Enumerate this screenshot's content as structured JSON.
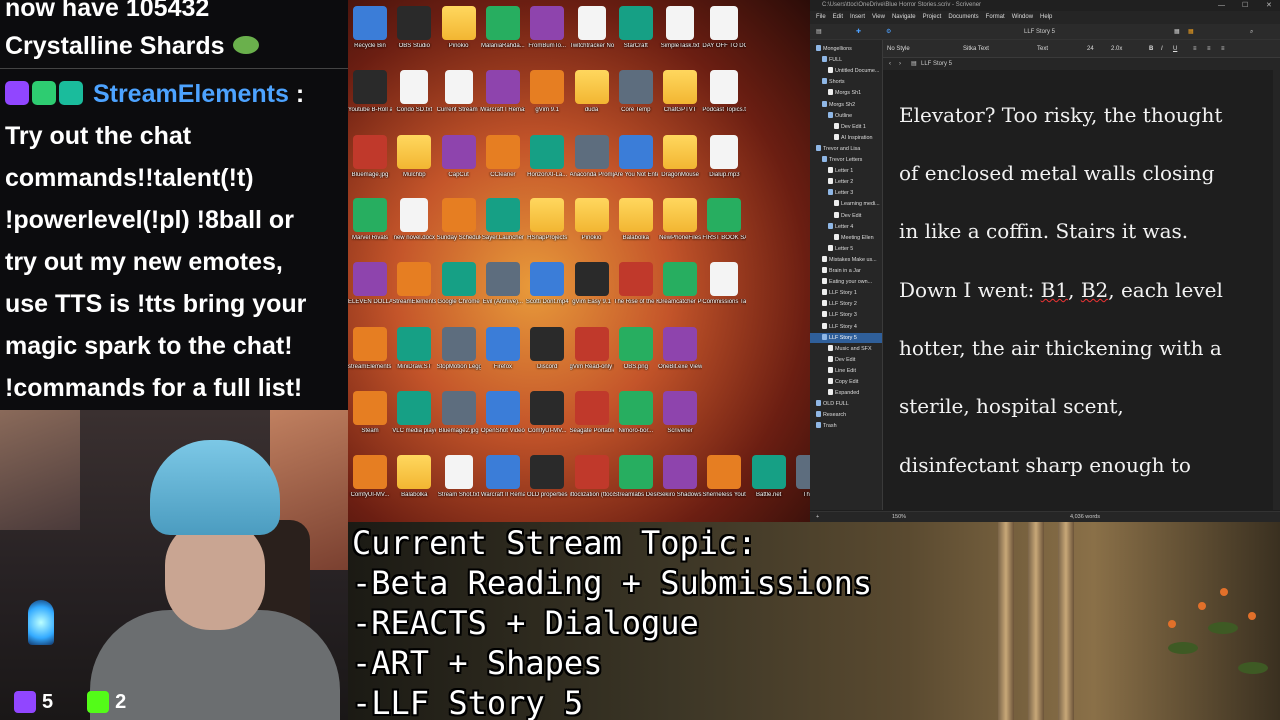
{
  "chat": {
    "line1": "now have 105432",
    "line2": "Crystalline Shards",
    "username": "StreamElements",
    "colon": " :",
    "msg": [
      "Try out the chat",
      "commands!!talent(!t)",
      "!powerlevel(!pl) !8ball or",
      "try out my new emotes,",
      "use TTS is !tts bring your",
      "magic spark to the chat!",
      "!commands for a full list!"
    ],
    "colors": {
      "username": "#4da3ff",
      "twitch": "#9146ff",
      "kick": "#53fc18"
    }
  },
  "counters": {
    "twitch": "5",
    "kick": "2"
  },
  "desktop": {
    "icons": [
      "Recycle Bin",
      "OBS Studio",
      "Pinokio",
      "MalaniaRahda...",
      "FromBumTo...",
      "Twitchtracker Notes.txt",
      "StarCraft",
      "SimpleTask.txt",
      "DAY OFF TO DO LIST.txt",
      "Youtube B-Roll and Music",
      "Condo SD.txt",
      "Current Stream Topic.txt",
      "Warcraft I Remastered",
      "gVim 9.1",
      "duda",
      "Core Temp",
      "ChatGPTVT",
      "Podcast Topics.txt",
      "Bluemage.jpg",
      "Mulchbp",
      "CapCut",
      "CCleaner",
      "HorizonXI-La...",
      "Anaconda Prompt (2)",
      "Are You Not Entertained.mp4",
      "DragonMouse",
      "Dialup.mp3",
      "Marvel Rivals",
      "new novel.docx",
      "Sunday Scheduler",
      "Sayer.Launcher",
      "HSnapProjects",
      "Pinokio",
      "Balabolka",
      "NewPhoneFiles",
      "FIRST BOOK SALE TO B...",
      "ELEVEN DOLLAR FOUNDATION",
      "StreamElements Stream...",
      "Google Chrome",
      "Evil (Archive)...",
      "Scotti Dont.mp4",
      "gVim Easy 9.1",
      "The Rise of the Knight",
      "Dreamcatcher Pretty Derby",
      "Commissions Tablet.txt",
      "streamElements Stream...",
      "MiniDraw.ST",
      "StopMotion Leggo",
      "Firefox",
      "Discord",
      "gVim Read-only 9.1",
      "OBS.png",
      "OneBit.exe Viewer",
      "Steam",
      "VLC media player",
      "Bluemage2.jpg",
      "OpenShot Video Editor",
      "ComfyUI-MV...",
      "Seagate Portable Disk",
      "Nimoro-bor...",
      "Scrivener",
      "ComfyUI-MV...",
      "Balabolka",
      "Stream Shot.txt",
      "Warcraft II Remastered",
      "OLD properties",
      "ittoclization (ttocc) - C...",
      "Streamlabs Desktop",
      "Sekiro Shadows D...",
      "Sherneless Youtube...",
      "Battle.net",
      "Thum..."
    ]
  },
  "scrivener": {
    "title": "C:\\Users\\ttoc\\OneDrive\\Blue Horror Stories.scriv - Scrivener",
    "menu": [
      "File",
      "Edit",
      "Insert",
      "View",
      "Navigate",
      "Project",
      "Documents",
      "Format",
      "Window",
      "Help"
    ],
    "toolbar_doc_title": "LLF Story 5",
    "format": {
      "style": "No Style",
      "font": "Sitka Text",
      "typeface": "Text",
      "size": "24",
      "spacing": "2.0x"
    },
    "binder": [
      {
        "label": "Mongellions",
        "level": 0,
        "folder": true
      },
      {
        "label": "FULL",
        "level": 1,
        "folder": true
      },
      {
        "label": "Untitled Docume...",
        "level": 2,
        "folder": false
      },
      {
        "label": "Shorts",
        "level": 1,
        "folder": true
      },
      {
        "label": "Morgs Sh1",
        "level": 2,
        "folder": false
      },
      {
        "label": "Morgs Sh2",
        "level": 1,
        "folder": true
      },
      {
        "label": "Outline",
        "level": 2,
        "folder": true
      },
      {
        "label": "Dev Edit 1",
        "level": 3,
        "folder": false
      },
      {
        "label": "AI Inspiration",
        "level": 3,
        "folder": false
      },
      {
        "label": "Trevor and Lisa",
        "level": 0,
        "folder": true
      },
      {
        "label": "Trevor Letters",
        "level": 1,
        "folder": true
      },
      {
        "label": "Letter 1",
        "level": 2,
        "folder": false
      },
      {
        "label": "Letter 2",
        "level": 2,
        "folder": false
      },
      {
        "label": "Letter 3",
        "level": 2,
        "folder": true
      },
      {
        "label": "Learning medi...",
        "level": 3,
        "folder": false
      },
      {
        "label": "Dev Edit",
        "level": 3,
        "folder": false
      },
      {
        "label": "Letter 4",
        "level": 2,
        "folder": true
      },
      {
        "label": "Meeting Ellen",
        "level": 3,
        "folder": false
      },
      {
        "label": "Letter 5",
        "level": 2,
        "folder": false
      },
      {
        "label": "Mistakes Make us...",
        "level": 1,
        "folder": false
      },
      {
        "label": "Brain in a Jar",
        "level": 1,
        "folder": false
      },
      {
        "label": "Eating your own...",
        "level": 1,
        "folder": false
      },
      {
        "label": "LLF Story 1",
        "level": 1,
        "folder": false
      },
      {
        "label": "LLF Story 2",
        "level": 1,
        "folder": false
      },
      {
        "label": "LLF Story 3",
        "level": 1,
        "folder": false
      },
      {
        "label": "LLF Story 4",
        "level": 1,
        "folder": false
      },
      {
        "label": "LLF Story 5",
        "level": 1,
        "folder": true,
        "selected": true
      },
      {
        "label": "Music and SFX",
        "level": 2,
        "folder": false
      },
      {
        "label": "Dev Edit",
        "level": 2,
        "folder": false
      },
      {
        "label": "Line Edit",
        "level": 2,
        "folder": false
      },
      {
        "label": "Copy Edit",
        "level": 2,
        "folder": false
      },
      {
        "label": "Expanded",
        "level": 2,
        "folder": false
      },
      {
        "label": "OLD FULL",
        "level": 0,
        "folder": true
      },
      {
        "label": "Research",
        "level": 0,
        "folder": true
      },
      {
        "label": "Trash",
        "level": 0,
        "folder": true
      }
    ],
    "editor_lines": [
      "Elevator? Too risky, the thought",
      "of enclosed metal walls closing",
      "in like a coffin. Stairs it was.",
      "Down I went: B1, B2, each level",
      "hotter, the air thickening with a",
      "sterile, hospital scent,",
      "disinfectant sharp enough to"
    ],
    "status": {
      "zoom": "150%",
      "words": "4,036 words"
    },
    "colors": {
      "selection": "#2f5f9a"
    }
  },
  "topic": {
    "lines": [
      "Current Stream Topic:",
      "-Beta Reading + Submissions",
      "-REACTS + Dialogue",
      "-ART + Shapes",
      "-LLF Story 5"
    ]
  }
}
